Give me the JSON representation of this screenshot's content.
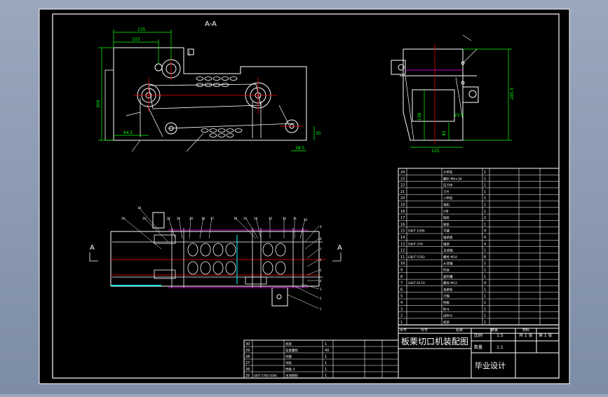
{
  "drawing": {
    "section_label": "A-A",
    "section_mark": "A",
    "title_block": {
      "drawing_title": "板栗切口机装配图",
      "project": "毕业设计",
      "scale_label": "比例",
      "scale_value": "1:5",
      "qty_label": "数量",
      "qty_value": "1:1",
      "sheet_total": "共 1 张",
      "sheet_num": "第 1 张"
    },
    "dimensions": {
      "top_width": "135",
      "top_inner": "103",
      "left_height": "309",
      "bottom_left": "64.5",
      "bottom_right": "38.5",
      "right_small": "35",
      "side_height": "285.5",
      "side_inner": "138",
      "side_bottom": "125",
      "side_mid": "22.5",
      "side_low": "45"
    },
    "parts_list": {
      "rows": [
        {
          "no": "24",
          "code": "",
          "name": "大带轮",
          "qty": "1"
        },
        {
          "no": "23",
          "code": "",
          "name": "螺钉 M6×16",
          "qty": "1"
        },
        {
          "no": "22",
          "code": "",
          "name": "压刀块",
          "qty": "1"
        },
        {
          "no": "21",
          "code": "",
          "name": "刀片",
          "qty": "1"
        },
        {
          "no": "20",
          "code": "",
          "name": "小带轮",
          "qty": "1"
        },
        {
          "no": "19",
          "code": "",
          "name": "电机",
          "qty": "1"
        },
        {
          "no": "18",
          "code": "",
          "name": "V带",
          "qty": "1"
        },
        {
          "no": "17",
          "code": "",
          "name": "链轮",
          "qty": "2"
        },
        {
          "no": "16",
          "code": "",
          "name": "链条",
          "qty": "1"
        },
        {
          "no": "15",
          "code": "GB/T 1096",
          "name": "平键",
          "qty": "4"
        },
        {
          "no": "14",
          "code": "",
          "name": "轴承座",
          "qty": "4"
        },
        {
          "no": "13",
          "code": "GB/T 276",
          "name": "轴承",
          "qty": "4"
        },
        {
          "no": "12",
          "code": "",
          "name": "主动轴",
          "qty": "1"
        },
        {
          "no": "11",
          "code": "GB/T 5783",
          "name": "螺栓 M10",
          "qty": "8"
        },
        {
          "no": "10",
          "code": "",
          "name": "从动轴",
          "qty": "1"
        },
        {
          "no": "9",
          "code": "",
          "name": "托架",
          "qty": "1"
        },
        {
          "no": "8",
          "code": "",
          "name": "盛料槽",
          "qty": "1"
        },
        {
          "no": "7",
          "code": "GB/T 6170",
          "name": "螺母 M12",
          "qty": "4"
        },
        {
          "no": "6",
          "code": "",
          "name": "张紧轮",
          "qty": "1"
        },
        {
          "no": "5",
          "code": "",
          "name": "刀轴",
          "qty": "1"
        },
        {
          "no": "4",
          "code": "",
          "name": "挡板",
          "qty": "1"
        },
        {
          "no": "3",
          "code": "",
          "name": "料斗",
          "qty": "1"
        },
        {
          "no": "2",
          "code": "",
          "name": "出料斗",
          "qty": "1"
        },
        {
          "no": "1",
          "code": "",
          "name": "机架",
          "qty": "1"
        }
      ],
      "header": {
        "no": "序号",
        "code": "代号",
        "name": "名称",
        "qty": "数量",
        "material": "材料"
      }
    },
    "lower_parts_list": {
      "rows": [
        {
          "no": "30",
          "code": "",
          "name": "机架",
          "qty": "1"
        },
        {
          "no": "29",
          "code": "",
          "name": "压紧螺栓",
          "qty": "40"
        },
        {
          "no": "28",
          "code": "",
          "name": "托辊",
          "qty": "1"
        },
        {
          "no": "27",
          "code": "",
          "name": "导轨",
          "qty": "1"
        },
        {
          "no": "26",
          "code": "",
          "name": "挡板 4",
          "qty": "1"
        },
        {
          "no": "25",
          "code": "GB/T 5783-2000",
          "name": "主动链轮",
          "qty": "1"
        }
      ]
    },
    "part_callouts": [
      "19",
      "24",
      "23",
      "22",
      "21",
      "20",
      "18",
      "17",
      "16",
      "15",
      "14",
      "13",
      "12",
      "11",
      "10",
      "9",
      "8",
      "7",
      "6",
      "5",
      "4",
      "3",
      "2",
      "1"
    ],
    "colors": {
      "paper": "#000000",
      "frame": "#ffffff",
      "outline": "#ffffff",
      "dimension": "#00ff00",
      "centerline": "#ff0000",
      "hidden": "#ff00ff",
      "sheet_bg": "#8593ad"
    }
  }
}
